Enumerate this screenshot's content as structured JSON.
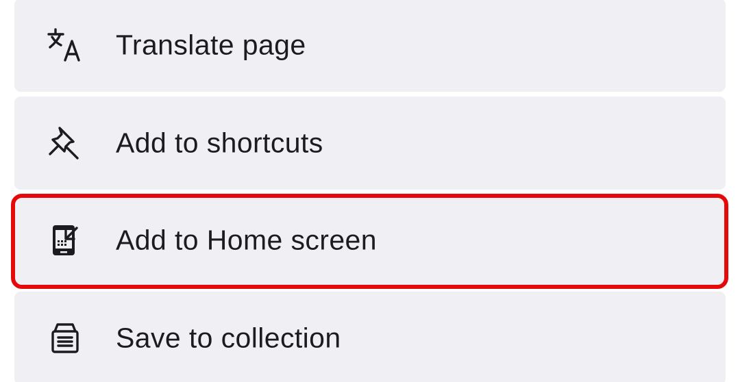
{
  "menu": {
    "items": [
      {
        "label": "Translate page",
        "icon": "translate-icon"
      },
      {
        "label": "Add to shortcuts",
        "icon": "pin-icon"
      },
      {
        "label": "Add to Home screen",
        "icon": "add-to-home-screen-icon"
      },
      {
        "label": "Save to collection",
        "icon": "collection-icon"
      }
    ]
  },
  "colors": {
    "item_background": "#f0eff4",
    "text": "#1c1b1f",
    "highlight": "#e5090a"
  }
}
